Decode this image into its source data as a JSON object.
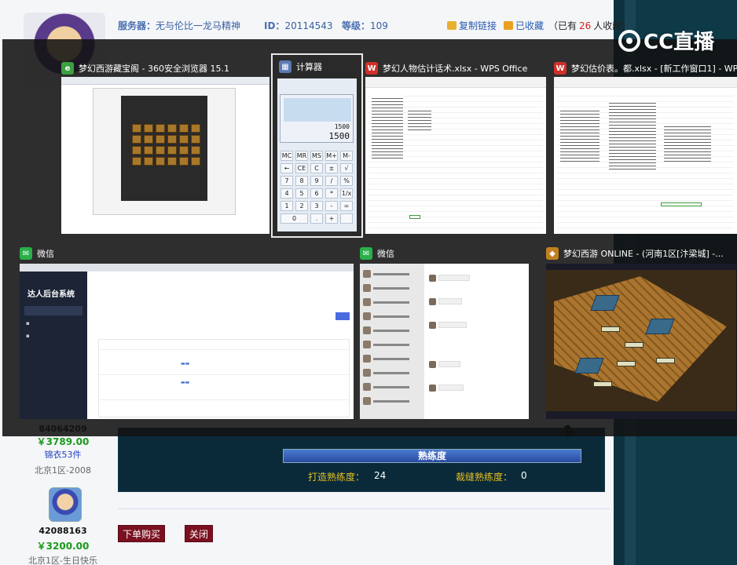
{
  "page": {
    "server_label": "服务器：",
    "server_value": "无与伦比一龙马精神",
    "id_label": "ID：",
    "id_value": "20114543",
    "level_label": "等级：",
    "level_value": "109",
    "copy_link": "复制链接",
    "favorited": "已收藏",
    "fav_count_prefix": "（已有",
    "fav_count": "26",
    "fav_count_suffix": "人收藏）",
    "left_seller1_id": "84064209",
    "left_seller1_price": "￥3789.00",
    "left_seller1_item": "锦衣53件",
    "left_seller1_server": "北京1区-2008",
    "left_seller2_id": "42088163",
    "left_seller2_price": "￥3200.00",
    "left_seller2_server": "北京1区-生日快乐",
    "skill_bar": "熟练度",
    "forge_label": "打造熟练度：",
    "forge_value": "24",
    "tailor_label": "裁缝熟练度：",
    "tailor_value": "0",
    "buy_button": "下单购买",
    "close_button": "关闭"
  },
  "logo": {
    "text": "CC直播"
  },
  "switcher": {
    "windows": [
      {
        "title": "梦幻西游藏宝阁 - 360安全浏览器 15.1",
        "icon": "browser-icon",
        "color": "#3aa040"
      },
      {
        "title": "计算器",
        "icon": "calculator-icon",
        "color": "#5a7ab0",
        "selected": true
      },
      {
        "title": "梦幻人物估计话术.xlsx - WPS Office",
        "icon": "wps-icon",
        "color": "#d0302a"
      },
      {
        "title": "梦幻估价表。都.xlsx - [新工作窗口1] - WPS",
        "icon": "wps-icon",
        "color": "#d0302a"
      },
      {
        "title": "微信",
        "icon": "wechat-icon",
        "color": "#2ab04a"
      },
      {
        "title": "微信",
        "icon": "wechat-icon",
        "color": "#2ab04a"
      },
      {
        "title": "梦幻西游 ONLINE - (河南1区[汴梁城] -...",
        "icon": "game-icon",
        "color": "#c08020"
      }
    ],
    "calculator": {
      "result_small": "1500",
      "result_big": "1500"
    },
    "admin": {
      "logo": "达人后台系统"
    }
  }
}
